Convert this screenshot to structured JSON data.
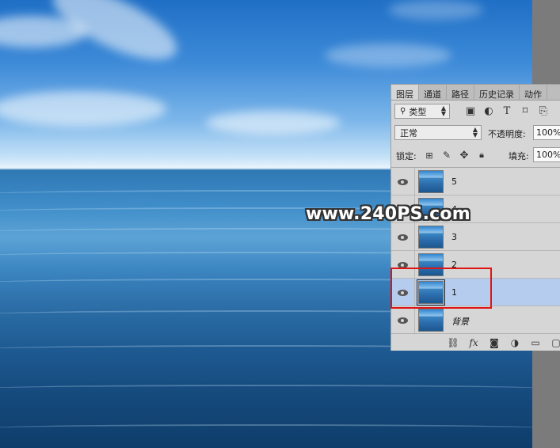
{
  "panel": {
    "tabs": [
      "图层",
      "通道",
      "路径",
      "历史记录",
      "动作"
    ],
    "active_tab": "图层",
    "filter": {
      "kind_label": "类型"
    },
    "blend": {
      "mode": "正常",
      "opacity_label": "不透明度:",
      "opacity_value": "100%"
    },
    "lock": {
      "label": "锁定:",
      "fill_label": "填充:",
      "fill_value": "100%"
    }
  },
  "layers": [
    {
      "name": "5",
      "visible": true,
      "selected": false
    },
    {
      "name": "4",
      "visible": true,
      "selected": false
    },
    {
      "name": "3",
      "visible": true,
      "selected": false
    },
    {
      "name": "2",
      "visible": true,
      "selected": false
    },
    {
      "name": "1",
      "visible": true,
      "selected": true
    },
    {
      "name": "背景",
      "visible": true,
      "selected": false
    }
  ],
  "watermark": "www.240PS.com",
  "colors": {
    "highlight": "#e01414",
    "selected_layer": "#b6ccef"
  }
}
